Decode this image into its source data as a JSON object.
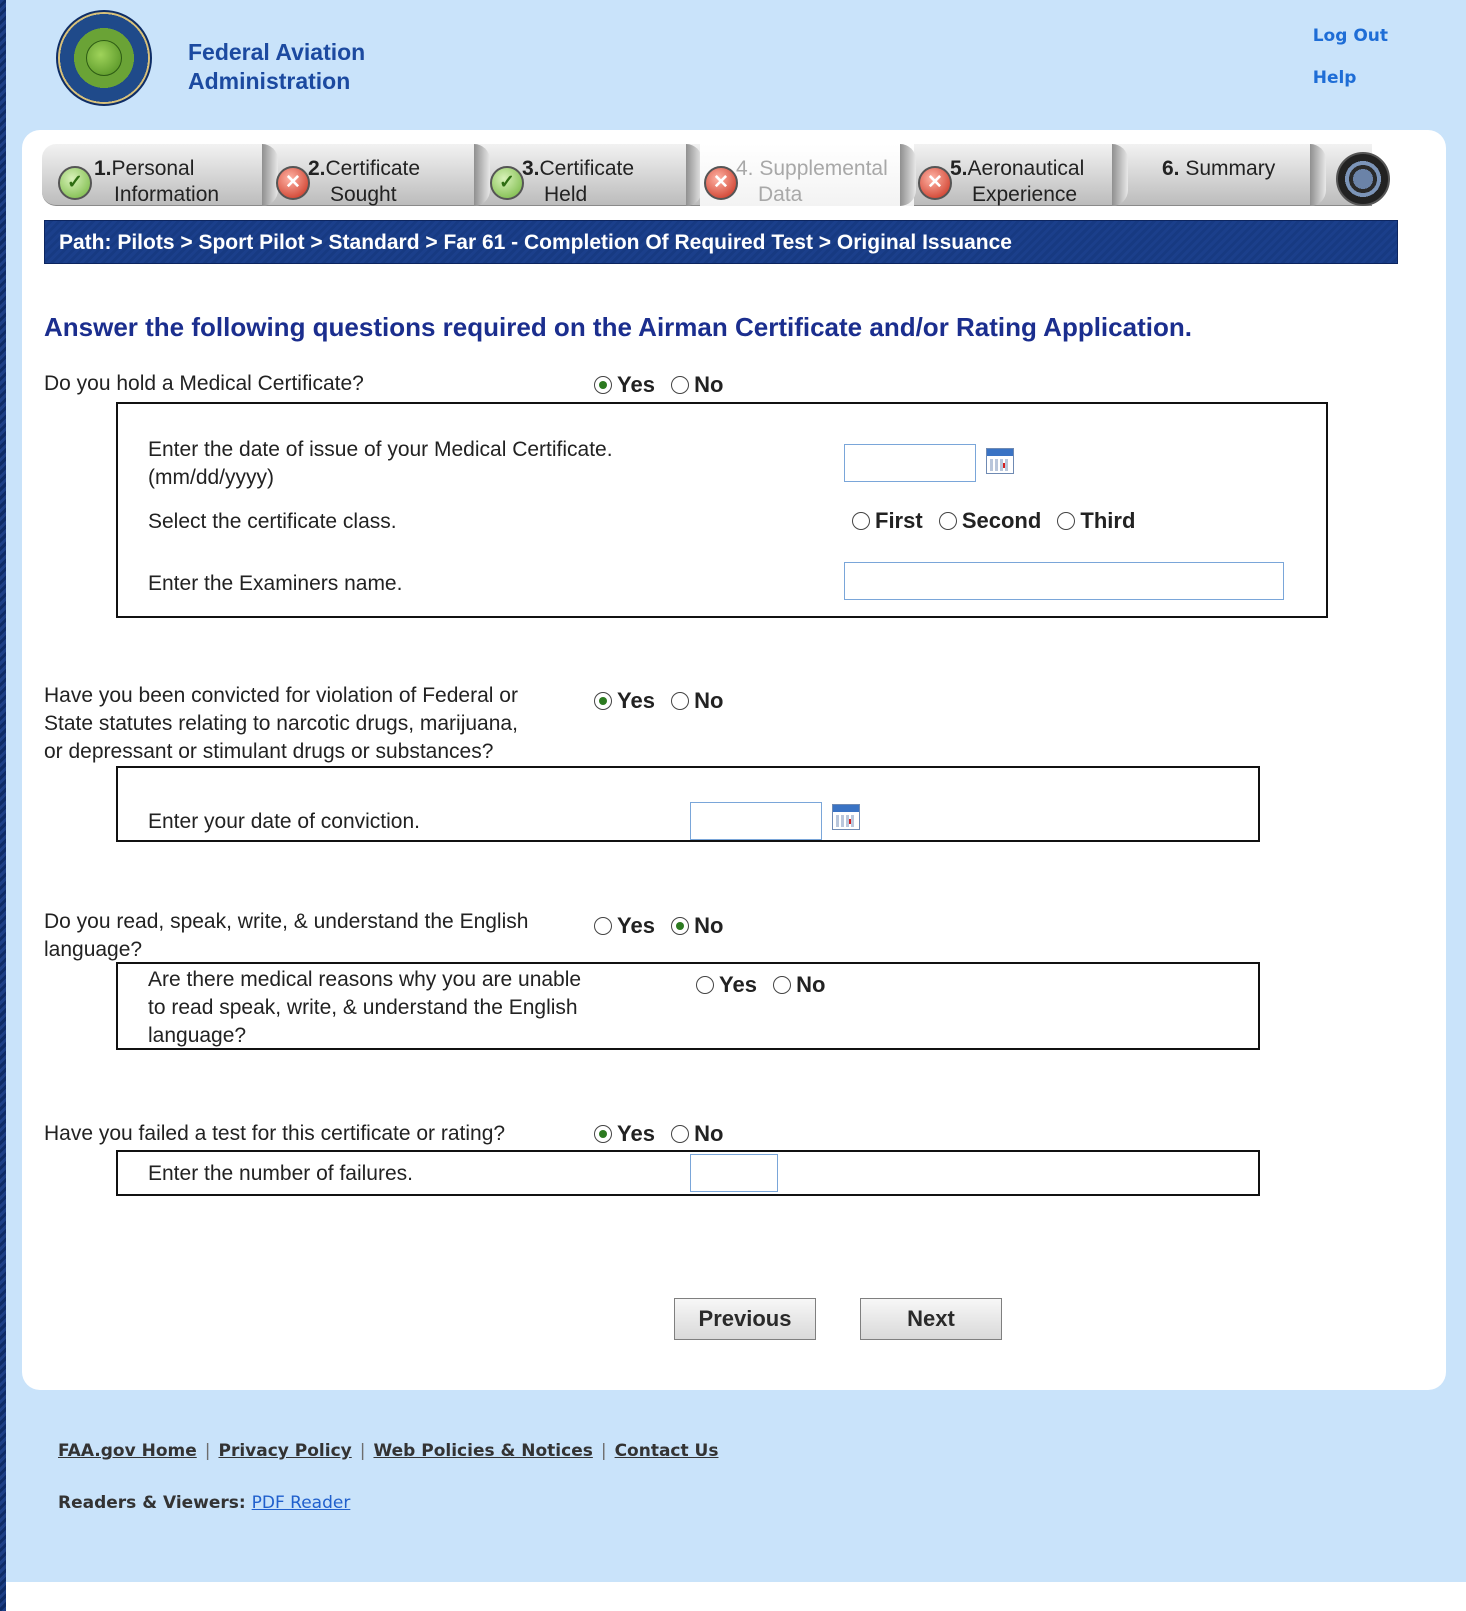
{
  "header": {
    "agency_line1": "Federal Aviation",
    "agency_line2": "Administration",
    "logout": "Log Out",
    "help": "Help"
  },
  "tabs": [
    {
      "num": "1.",
      "line1": "Personal",
      "line2": "Information",
      "status": "complete"
    },
    {
      "num": "2.",
      "line1": "Certificate",
      "line2": "Sought",
      "status": "error"
    },
    {
      "num": "3.",
      "line1": "Certificate",
      "line2": "Held",
      "status": "complete"
    },
    {
      "num": "4.",
      "line1": "Supplemental",
      "line2": "Data",
      "status": "error",
      "active": true
    },
    {
      "num": "5.",
      "line1": "Aeronautical",
      "line2": "Experience",
      "status": "error"
    },
    {
      "num": "6.",
      "line1": "Summary",
      "line2": "",
      "status": "none"
    }
  ],
  "path": "Path: Pilots > Sport Pilot > Standard > Far 61 - Completion Of Required Test > Original Issuance",
  "heading": "Answer the following questions required on the Airman Certificate and/or Rating Application.",
  "q1": {
    "text": "Do you hold a Medical Certificate?",
    "yes": "Yes",
    "no": "No",
    "selected": "Yes",
    "date_label_1": "Enter the date of issue of your Medical Certificate.",
    "date_label_2": "(mm/dd/yyyy)",
    "date_value": "",
    "class_label": "Select the certificate class.",
    "class_options": [
      "First",
      "Second",
      "Third"
    ],
    "examiner_label": "Enter the Examiners name.",
    "examiner_value": ""
  },
  "q2": {
    "text_1": "Have you been convicted for violation of Federal or",
    "text_2": "State statutes relating to narcotic drugs, marijuana,",
    "text_3": "or depressant or stimulant drugs or substances?",
    "yes": "Yes",
    "no": "No",
    "selected": "Yes",
    "date_label": "Enter your date of conviction.",
    "date_value": ""
  },
  "q3": {
    "text_1": "Do you read, speak, write, & understand the English",
    "text_2": "language?",
    "yes": "Yes",
    "no": "No",
    "selected": "No",
    "sub_text_1": "Are there medical reasons why you are unable",
    "sub_text_2": "to read speak, write, & understand the English",
    "sub_text_3": "language?",
    "sub_yes": "Yes",
    "sub_no": "No"
  },
  "q4": {
    "text": "Have you failed a test for this certificate or rating?",
    "yes": "Yes",
    "no": "No",
    "selected": "Yes",
    "failures_label": "Enter the number of failures.",
    "failures_value": ""
  },
  "buttons": {
    "previous": "Previous",
    "next": "Next"
  },
  "footer": {
    "links": [
      "FAA.gov Home",
      "Privacy Policy",
      "Web Policies & Notices",
      "Contact Us"
    ],
    "readers_label": "Readers & Viewers:",
    "pdf_reader": "PDF Reader"
  }
}
